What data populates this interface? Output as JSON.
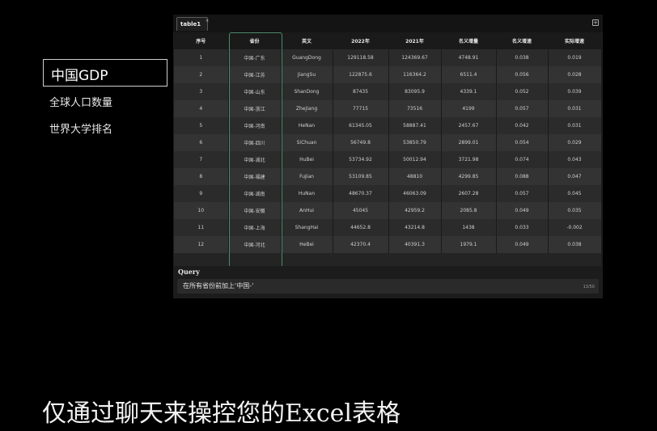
{
  "menu": {
    "items": [
      {
        "label": "中国GDP",
        "active": true
      },
      {
        "label": "全球人口数量",
        "active": false
      },
      {
        "label": "世界大学排名",
        "active": false
      }
    ]
  },
  "tabs": [
    {
      "label": "table1",
      "close": "×"
    }
  ],
  "add_tab_label": "+",
  "table": {
    "headers": [
      "序号",
      "省份",
      "英文",
      "2022年",
      "2021年",
      "名义增量",
      "名义增速",
      "实际增速"
    ],
    "rows": [
      [
        "1",
        "中国-广东",
        "GuangDong",
        "129118.58",
        "124369.67",
        "4748.91",
        "0.038",
        "0.019"
      ],
      [
        "2",
        "中国-江苏",
        "JiangSu",
        "122875.6",
        "116364.2",
        "6511.4",
        "0.056",
        "0.028"
      ],
      [
        "3",
        "中国-山东",
        "ShanDong",
        "87435",
        "83095.9",
        "4339.1",
        "0.052",
        "0.039"
      ],
      [
        "4",
        "中国-浙江",
        "ZheJiang",
        "77715",
        "73516",
        "4199",
        "0.057",
        "0.031"
      ],
      [
        "5",
        "中国-河南",
        "HeNan",
        "61345.05",
        "58887.41",
        "2457.67",
        "0.042",
        "0.031"
      ],
      [
        "6",
        "中国-四川",
        "SiChuan",
        "56749.8",
        "53850.79",
        "2899.01",
        "0.054",
        "0.029"
      ],
      [
        "7",
        "中国-湖北",
        "HuBei",
        "53734.92",
        "50012.94",
        "3721.98",
        "0.074",
        "0.043"
      ],
      [
        "8",
        "中国-福建",
        "FuJian",
        "53109.85",
        "48810",
        "4299.85",
        "0.088",
        "0.047"
      ],
      [
        "9",
        "中国-湖南",
        "HuNan",
        "48670.37",
        "46063.09",
        "2607.28",
        "0.057",
        "0.045"
      ],
      [
        "10",
        "中国-安徽",
        "AnHui",
        "45045",
        "42959.2",
        "2085.8",
        "0.049",
        "0.035"
      ],
      [
        "11",
        "中国-上海",
        "ShangHai",
        "44652.8",
        "43214.8",
        "1438",
        "0.033",
        "-0.002"
      ],
      [
        "12",
        "中国-河北",
        "HeBei",
        "42370.4",
        "40391.3",
        "1979.1",
        "0.049",
        "0.038"
      ]
    ]
  },
  "query": {
    "label": "Query",
    "value": "在所有省份前加上'中国-'",
    "counter": "13/50"
  },
  "caption": "仅通过聊天来操控您的Excel表格",
  "colors": {
    "background": "#000000",
    "panel": "#1c1c1c",
    "highlight": "#4a8a6a"
  }
}
